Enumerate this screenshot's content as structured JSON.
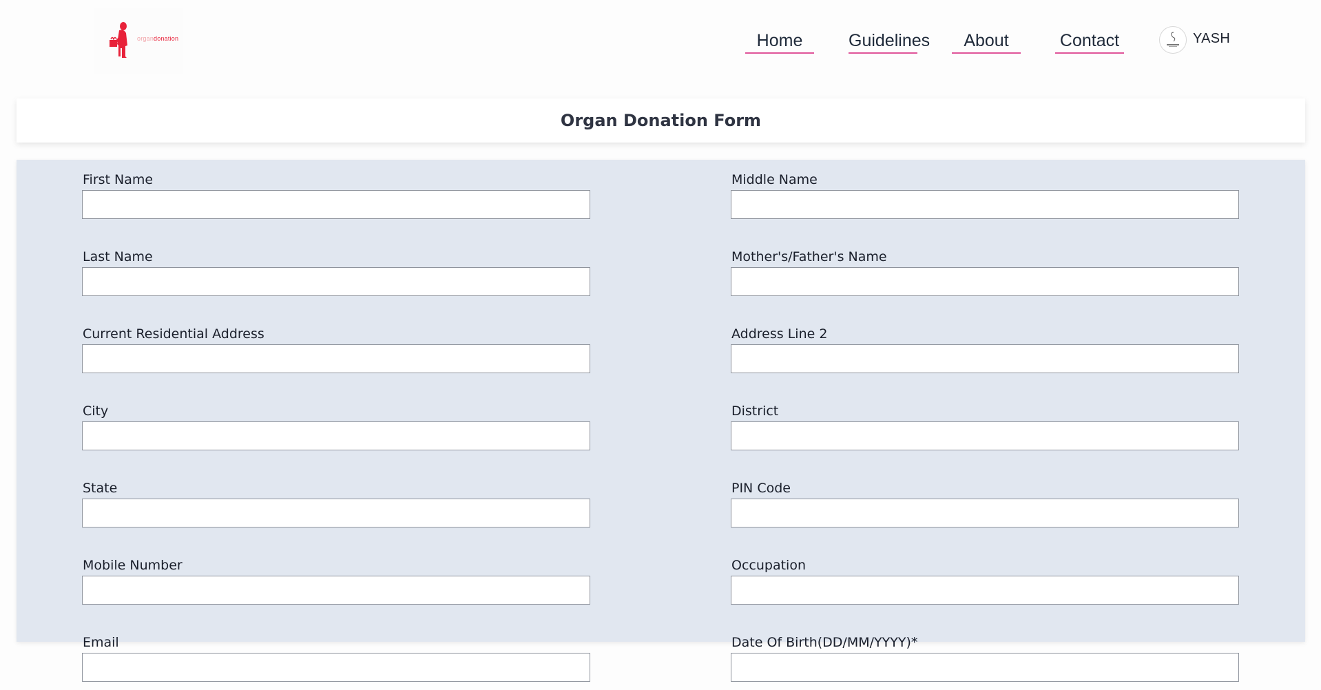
{
  "brand": {
    "logo_text_part1": "organ",
    "logo_text_part2": "donation",
    "logo_color": "#e8223a"
  },
  "nav": {
    "items": [
      {
        "label": "Home"
      },
      {
        "label": "Guidelines"
      },
      {
        "label": "About"
      },
      {
        "label": "Contact"
      }
    ],
    "underline_color": "#e0559a",
    "user_name": "YASH",
    "avatar_icon": "user-avatar-icon"
  },
  "page": {
    "title": "Organ Donation Form"
  },
  "form": {
    "background": "#e1e7f0",
    "fields": [
      {
        "label": "First Name",
        "value": ""
      },
      {
        "label": "Middle Name",
        "value": ""
      },
      {
        "label": "Last Name",
        "value": ""
      },
      {
        "label": "Mother's/Father's Name",
        "value": ""
      },
      {
        "label": "Current Residential Address",
        "value": ""
      },
      {
        "label": "Address Line 2",
        "value": ""
      },
      {
        "label": "City",
        "value": ""
      },
      {
        "label": "District",
        "value": ""
      },
      {
        "label": "State",
        "value": ""
      },
      {
        "label": "PIN Code",
        "value": ""
      },
      {
        "label": "Mobile Number",
        "value": ""
      },
      {
        "label": "Occupation",
        "value": ""
      },
      {
        "label": "Email",
        "value": ""
      },
      {
        "label": "Date Of Birth(DD/MM/YYYY)*",
        "value": ""
      }
    ]
  }
}
